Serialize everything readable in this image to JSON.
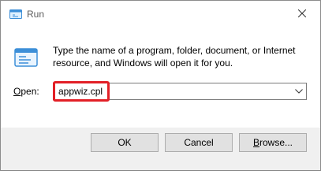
{
  "window": {
    "title": "Run",
    "close_glyph": "✕",
    "title_icon": "run-app-icon",
    "accent": "#1e7bd6"
  },
  "content": {
    "description": "Type the name of a program, folder, document, or Internet resource, and Windows will open it for you.",
    "open_label_mnemonic": "O",
    "open_label_rest": "pen:",
    "open_value": "appwiz.cpl",
    "dropdown_icon": "chevron-down-icon",
    "highlight_color": "#e21f26"
  },
  "buttons": {
    "ok": "OK",
    "cancel": "Cancel",
    "browse_mnemonic": "B",
    "browse_rest": "rowse..."
  }
}
